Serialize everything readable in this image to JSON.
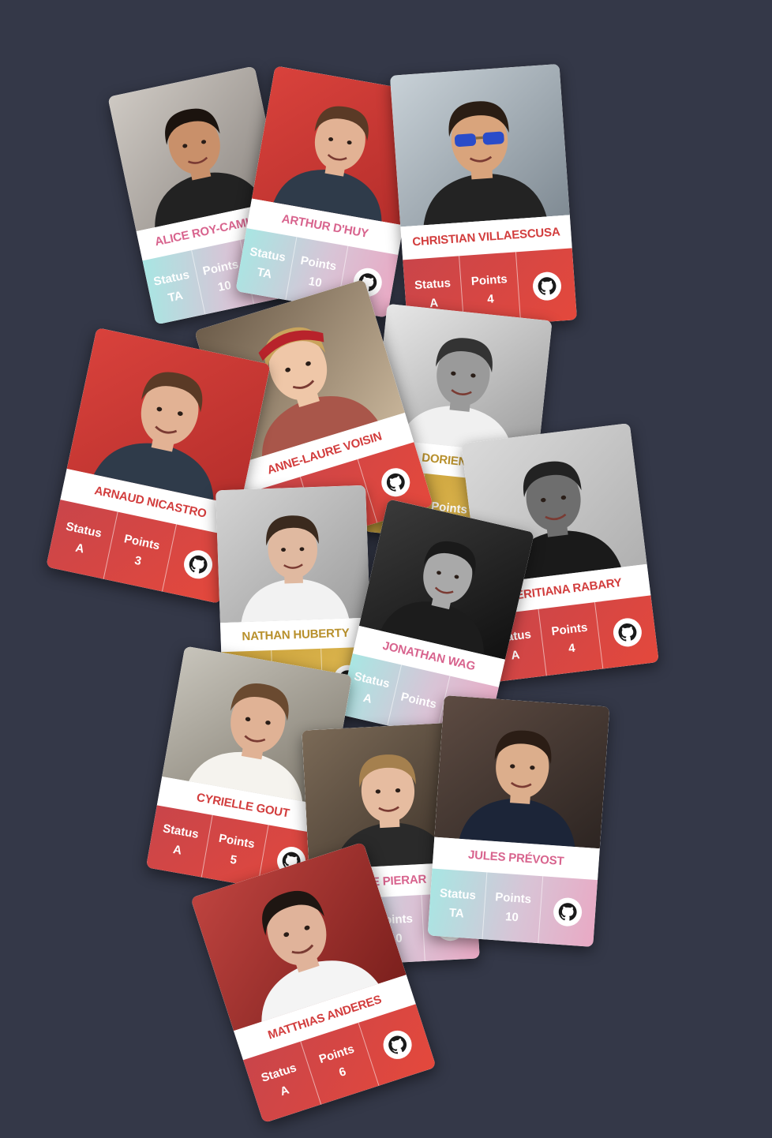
{
  "colors": {
    "background": "#343848",
    "red": "#d23d3d",
    "pink": "#d8648e",
    "teal": "#a8e6e3",
    "gold": "#c9a03a"
  },
  "labels": {
    "status": "Status",
    "points": "Points"
  },
  "cards": [
    {
      "name": "ALICE ROY-CAMILLE",
      "status": "TA",
      "points": "10",
      "theme": "pink",
      "photo": "woman-leather-jacket",
      "github_icon": "github-icon"
    },
    {
      "name": "ARTHUR D'HUY",
      "status": "TA",
      "points": "10",
      "theme": "pink",
      "photo": "man-red-background",
      "github_icon": "github-icon"
    },
    {
      "name": "CHRISTIAN VILLAESCUSA",
      "status": "A",
      "points": "4",
      "theme": "red",
      "photo": "man-blue-sunglasses",
      "github_icon": "github-icon"
    },
    {
      "name": "DORIEN PO",
      "status": "",
      "points": "",
      "theme": "gold",
      "photo": "man-smiling-bw",
      "github_icon": "github-icon"
    },
    {
      "name": "ANNE-LAURE VOISIN",
      "status": "",
      "points": "",
      "theme": "red",
      "photo": "woman-red-headband",
      "github_icon": "github-icon"
    },
    {
      "name": "ARNAUD NICASTRO",
      "status": "A",
      "points": "3",
      "theme": "red",
      "photo": "man-red-background",
      "github_icon": "github-icon"
    },
    {
      "name": "HERITIANA RABARY",
      "status": "A",
      "points": "4",
      "theme": "red",
      "photo": "man-crossed-arms",
      "github_icon": "github-icon"
    },
    {
      "name": "NATHAN HUBERTY",
      "status": "",
      "points": "",
      "theme": "gold",
      "photo": "man-smiling-grey",
      "github_icon": "github-icon"
    },
    {
      "name": "JONATHAN WAG",
      "status": "A",
      "points": "",
      "theme": "pink",
      "photo": "man-bw-portrait",
      "github_icon": "github-icon"
    },
    {
      "name": "CYRIELLE GOUT",
      "status": "A",
      "points": "5",
      "theme": "red",
      "photo": "woman-laptop",
      "github_icon": "github-icon"
    },
    {
      "name": "MIE PIERAR",
      "status": "",
      "points": "10",
      "theme": "pink",
      "photo": "woman-portrait",
      "github_icon": "github-icon"
    },
    {
      "name": "JULES PRÉVOST",
      "status": "TA",
      "points": "10",
      "theme": "pink",
      "photo": "man-side-profile",
      "github_icon": "github-icon"
    },
    {
      "name": "MATTHIAS ANDERES",
      "status": "A",
      "points": "6",
      "theme": "red",
      "photo": "man-polo-shirt",
      "github_icon": "github-icon"
    }
  ]
}
